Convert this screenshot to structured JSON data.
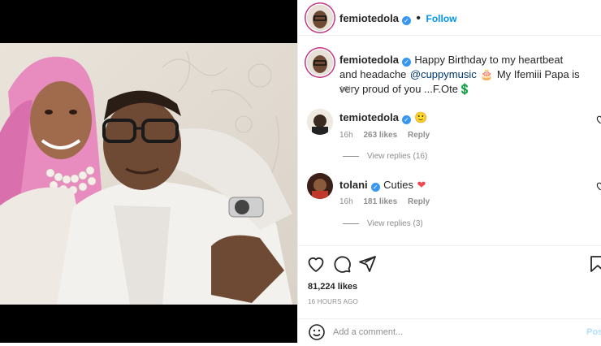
{
  "post": {
    "author": "femiotedola",
    "follow_label": "Follow",
    "caption_part1": "Happy Birthday to my heartbeat and headache",
    "mention": "@cuppymusic",
    "caption_part2": "My Ifemiii Papa is very proud of you ...F.Ote",
    "caption_emoji_1": "🎂",
    "caption_emoji_2": "💲",
    "caption_age": "16h"
  },
  "comments": [
    {
      "username": "temiotedola",
      "text": "🙂",
      "age": "16h",
      "likes": "263 likes",
      "reply_label": "Reply",
      "view_replies": "View replies (16)"
    },
    {
      "username": "tolani",
      "text": "Cuties",
      "emoji": "❤",
      "age": "16h",
      "likes": "181 likes",
      "reply_label": "Reply",
      "view_replies": "View replies (3)"
    }
  ],
  "actions": {
    "likes_count": "81,224 likes",
    "timestamp": "16 HOURS AGO",
    "comment_placeholder": "Add a comment...",
    "post_label": "Post"
  },
  "icons": {
    "like": "heart-icon",
    "comment": "comment-bubble-icon",
    "share": "paper-plane-icon",
    "save": "bookmark-icon",
    "emoji": "smiley-icon",
    "verified": "verified-badge-icon"
  },
  "colors": {
    "link_blue": "#0095f6",
    "verified_blue": "#3897f0",
    "heart_red": "#ed4956"
  }
}
